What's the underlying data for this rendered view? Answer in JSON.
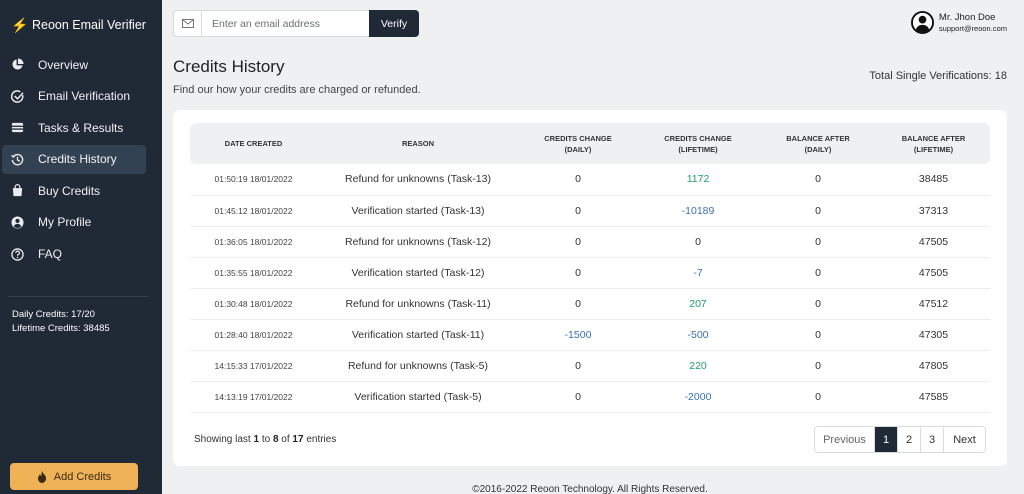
{
  "sidebar": {
    "brand": "Reoon Email Verifier",
    "items": [
      {
        "label": "Overview",
        "icon": "pie-chart-icon",
        "active": false
      },
      {
        "label": "Email Verification",
        "icon": "check-circle-icon",
        "active": false
      },
      {
        "label": "Tasks & Results",
        "icon": "list-icon",
        "active": false
      },
      {
        "label": "Credits History",
        "icon": "history-icon",
        "active": true
      },
      {
        "label": "Buy Credits",
        "icon": "shopping-bag-icon",
        "active": false
      },
      {
        "label": "My Profile",
        "icon": "user-circle-icon",
        "active": false
      },
      {
        "label": "FAQ",
        "icon": "question-circle-icon",
        "active": false
      }
    ],
    "daily_credits": "Daily Credits: 17/20",
    "lifetime_credits": "Lifetime Credits: 38485",
    "add_credits_label": "Add Credits"
  },
  "search": {
    "placeholder": "Enter an email address",
    "value": "",
    "button_label": "Verify"
  },
  "user": {
    "name": "Mr. Jhon Doe",
    "email": "support@reoon.com"
  },
  "page": {
    "title": "Credits History",
    "subtitle": "Find our how your credits are charged or refunded.",
    "total_single": "Total Single Verifications: 18"
  },
  "table": {
    "headers": [
      [
        "DATE CREATED"
      ],
      [
        "REASON"
      ],
      [
        "CREDITS CHANGE",
        "(DAILY)"
      ],
      [
        "CREDITS CHANGE",
        "(LIFETIME)"
      ],
      [
        "BALANCE AFTER",
        "(DAILY)"
      ],
      [
        "BALANCE AFTER",
        "(LIFETIME)"
      ]
    ],
    "rows": [
      {
        "date": "01:50:19 18/01/2022",
        "reason": "Refund for unknowns (Task-13)",
        "change_daily": "0",
        "change_lifetime": "1172",
        "balance_daily": "0",
        "balance_lifetime": "38485"
      },
      {
        "date": "01:45:12 18/01/2022",
        "reason": "Verification started (Task-13)",
        "change_daily": "0",
        "change_lifetime": "-10189",
        "balance_daily": "0",
        "balance_lifetime": "37313"
      },
      {
        "date": "01:36:05 18/01/2022",
        "reason": "Refund for unknowns (Task-12)",
        "change_daily": "0",
        "change_lifetime": "0",
        "balance_daily": "0",
        "balance_lifetime": "47505"
      },
      {
        "date": "01:35:55 18/01/2022",
        "reason": "Verification started (Task-12)",
        "change_daily": "0",
        "change_lifetime": "-7",
        "balance_daily": "0",
        "balance_lifetime": "47505"
      },
      {
        "date": "01:30:48 18/01/2022",
        "reason": "Refund for unknowns (Task-11)",
        "change_daily": "0",
        "change_lifetime": "207",
        "balance_daily": "0",
        "balance_lifetime": "47512"
      },
      {
        "date": "01:28:40 18/01/2022",
        "reason": "Verification started (Task-11)",
        "change_daily": "-1500",
        "change_lifetime": "-500",
        "balance_daily": "0",
        "balance_lifetime": "47305"
      },
      {
        "date": "14:15:33 17/01/2022",
        "reason": "Refund for unknowns (Task-5)",
        "change_daily": "0",
        "change_lifetime": "220",
        "balance_daily": "0",
        "balance_lifetime": "47805"
      },
      {
        "date": "14:13:19 17/01/2022",
        "reason": "Verification started (Task-5)",
        "change_daily": "0",
        "change_lifetime": "-2000",
        "balance_daily": "0",
        "balance_lifetime": "47585"
      }
    ]
  },
  "pagination": {
    "showing_prefix": "Showing last",
    "from": "1",
    "to_word": "to",
    "to": "8",
    "of_word": "of",
    "total": "17",
    "suffix": "entries",
    "prev_label": "Previous",
    "pages": [
      "1",
      "2",
      "3"
    ],
    "current_page": "1",
    "next_label": "Next"
  },
  "footer": "©2016-2022 Reoon Technology. All Rights Reserved.",
  "colors": {
    "sidebar_bg": "#1f2a36",
    "accent": "#f0b257",
    "positive": "#1e9d6a",
    "negative": "#3b71b4"
  }
}
